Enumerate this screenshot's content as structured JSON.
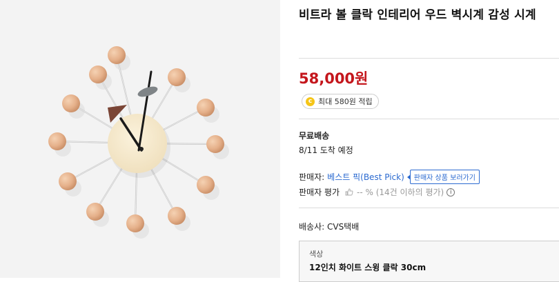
{
  "product": {
    "title": "비트라 볼 클락 인테리어 우드 벽시계 감성 시계",
    "price": "58,000원"
  },
  "points": {
    "coin_symbol": "c",
    "label": "최대 580원 적립"
  },
  "shipping": {
    "title": "무료배송",
    "arrival": "8/11 도착 예정"
  },
  "seller": {
    "label": "판매자:",
    "name": "베스트 픽(Best Pick)",
    "tooltip": "판매자 상품 보러가기"
  },
  "rating": {
    "label": "판매자 평가",
    "value": "-- % (14건 이하의 평가)",
    "info_symbol": "i"
  },
  "carrier": {
    "text": "배송사: CVS택배"
  },
  "option": {
    "label": "색상",
    "value": "12인치 화이트 스윙 클락 30cm"
  },
  "colors": {
    "price": "#c4161c",
    "link": "#2b6ad0",
    "ball": "#e8b791",
    "clock_face": "#f7ecd1"
  }
}
